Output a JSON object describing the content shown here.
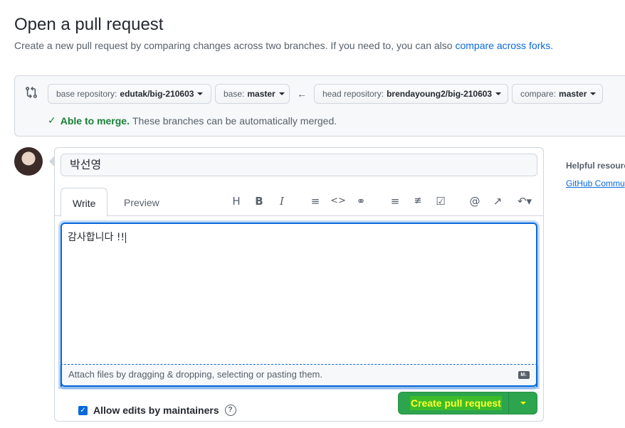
{
  "header": {
    "title": "Open a pull request",
    "subtitle": "Create a new pull request by comparing changes across two branches. If you need to, you can also",
    "subtitle_link": "compare across forks."
  },
  "compare": {
    "base_repo_label": "base repository:",
    "base_repo_value": "edutak/big-210603",
    "base_label": "base:",
    "base_value": "master",
    "head_repo_label": "head repository:",
    "head_repo_value": "brendayoung2/big-210603",
    "compare_label": "compare:",
    "compare_value": "master",
    "merge_status": "Able to merge.",
    "merge_detail": "These branches can be automatically merged."
  },
  "composer": {
    "title_value": "박선영",
    "tabs": [
      {
        "label": "Write"
      },
      {
        "label": "Preview"
      }
    ],
    "toolbar_icons": [
      "heading-icon",
      "bold-icon",
      "italic-icon",
      "quote-icon",
      "code-icon",
      "link-icon",
      "bulleted-list-icon",
      "numbered-list-icon",
      "task-list-icon",
      "mention-icon",
      "reference-icon",
      "reply-icon"
    ],
    "body_value": "감사합니다 !!",
    "attach_text": "Attach files by dragging & dropping, selecting or pasting them.",
    "markdown_badge": "M↓",
    "allow_edits_label": "Allow edits by maintainers",
    "create_button": "Create pull request"
  },
  "sidebar": {
    "heading": "Helpful resourc",
    "link": "GitHub Commu"
  },
  "colors": {
    "primary_button": "#2da44e",
    "link": "#0969da",
    "success": "#1a7f37"
  }
}
